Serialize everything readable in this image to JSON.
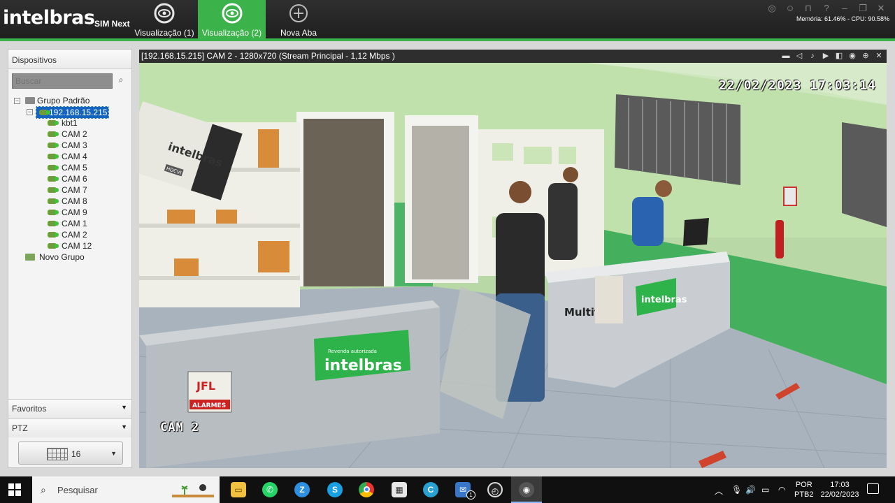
{
  "app": {
    "brand": "intelbras",
    "product": "SIM Next",
    "tabs": [
      {
        "label": "Visualização (1)",
        "icon": "eye-icon",
        "active": false
      },
      {
        "label": "Visualização (2)",
        "icon": "eye-icon",
        "active": true
      },
      {
        "label": "Nova Aba",
        "icon": "plus-circle-icon",
        "active": false
      }
    ],
    "stats": "Memória: 61.46% - CPU: 90.58%"
  },
  "sidebar": {
    "title": "Dispositivos",
    "search_placeholder": "Buscar",
    "tree": {
      "group": "Grupo Padrão",
      "device": "192.168.15.215",
      "channels": [
        "kbt1",
        "CAM 2",
        "CAM 3",
        "CAM 4",
        "CAM 5",
        "CAM 6",
        "CAM 7",
        "CAM 8",
        "CAM 9",
        "CAM 1",
        "CAM 2",
        "CAM 12"
      ],
      "new_group": "Novo Grupo"
    },
    "favorites": "Favoritos",
    "ptz": "PTZ",
    "layout_count": "16"
  },
  "video": {
    "header": "[192.168.15.215] CAM 2 - 1280x720 (Stream Principal - 1,12 Mbps )",
    "osd_timestamp": "22/02/2023 17:03:14",
    "osd_camera": "CAM 2",
    "scene_text": {
      "box_logo": "intelbras",
      "box_tag": "HDCVI",
      "sign_small": "Revenda autorizada",
      "sign_large": "intelbras",
      "sign_right": "intelbras",
      "counter_text": "Multita",
      "alarm_logo": "JFL",
      "alarm_text": "ALARMES"
    }
  },
  "taskbar": {
    "search_label": "Pesquisar",
    "language": [
      "POR",
      "PTB2"
    ],
    "time": "17:03",
    "date": "22/02/2023",
    "mail_badge": "1"
  }
}
